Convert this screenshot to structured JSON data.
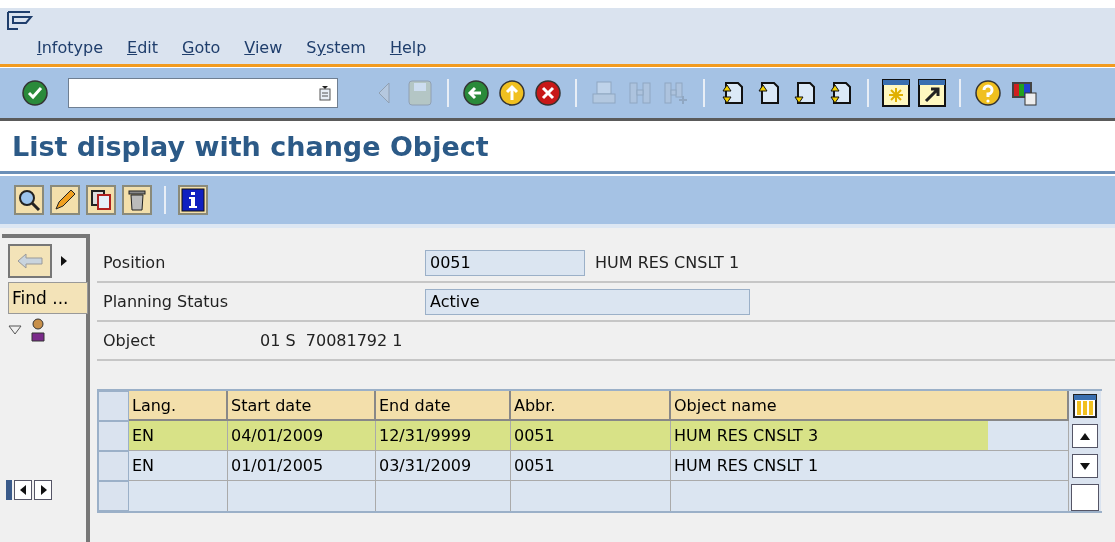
{
  "menu": [
    {
      "key": "I",
      "post": "nfotype"
    },
    {
      "key": "E",
      "post": "dit"
    },
    {
      "key": "G",
      "post": "oto"
    },
    {
      "key": "V",
      "post": "iew"
    },
    {
      "pre": "S",
      "key": "y",
      "post": "stem"
    },
    {
      "key": "H",
      "post": "elp"
    }
  ],
  "toolbar": [
    {
      "kind": "button",
      "disabled": false
    },
    {
      "kind": "command-field"
    },
    {
      "kind": "button",
      "disabled": true
    },
    {
      "kind": "button",
      "disabled": true
    },
    {
      "kind": "separator"
    },
    {
      "kind": "button",
      "disabled": false
    },
    {
      "kind": "button",
      "disabled": false
    },
    {
      "kind": "button",
      "disabled": false
    },
    {
      "kind": "separator"
    },
    {
      "kind": "button",
      "disabled": true
    },
    {
      "kind": "button",
      "disabled": true
    },
    {
      "kind": "button",
      "disabled": true
    },
    {
      "kind": "separator"
    },
    {
      "kind": "button",
      "disabled": false
    },
    {
      "kind": "button",
      "disabled": false
    },
    {
      "kind": "button",
      "disabled": false
    },
    {
      "kind": "button",
      "disabled": false
    },
    {
      "kind": "separator"
    },
    {
      "kind": "button",
      "disabled": false
    },
    {
      "kind": "button",
      "disabled": false
    },
    {
      "kind": "separator"
    },
    {
      "kind": "button",
      "disabled": false
    },
    {
      "kind": "button",
      "disabled": false
    }
  ],
  "title": "List display with change Object",
  "app_toolbar": [
    {
      "kind": "button"
    },
    {
      "kind": "button"
    },
    {
      "kind": "button"
    },
    {
      "kind": "button"
    },
    {
      "kind": "separator"
    },
    {
      "kind": "button"
    }
  ],
  "navigator": {
    "find_button": "Find ..."
  },
  "form": {
    "position": {
      "label": "Position",
      "value": "0051",
      "text": "HUM RES CNSLT 1"
    },
    "planning_status": {
      "label": "Planning Status",
      "value": "Active"
    },
    "object": {
      "label": "Object",
      "value": "01 S  70081792 1"
    }
  },
  "table": {
    "columns": [
      "Lang.",
      "Start date",
      "End date",
      "Abbr.",
      "Object name"
    ],
    "rows": [
      {
        "cells": [
          "EN",
          "04/01/2009",
          "12/31/9999",
          "0051",
          "HUM RES CNSLT 3"
        ],
        "highlighted": true
      },
      {
        "cells": [
          "EN",
          "01/01/2005",
          "03/31/2009",
          "0051",
          "HUM RES CNSLT 1"
        ],
        "highlighted": false
      }
    ]
  }
}
